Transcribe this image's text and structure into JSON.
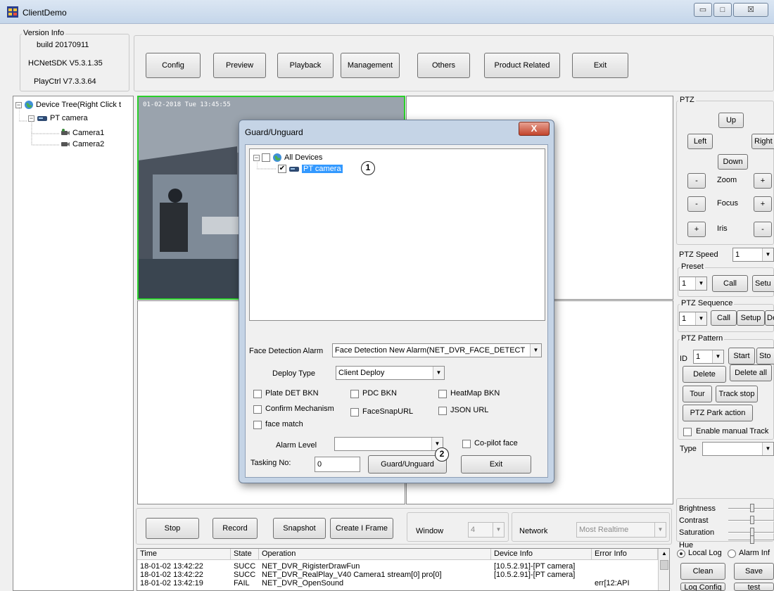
{
  "window": {
    "title": "ClientDemo",
    "minimize": "▭",
    "maximize": "□",
    "close": "☒"
  },
  "version": {
    "legend": "Version Info",
    "build": "build 20170911",
    "sdk": "HCNetSDK V5.3.1.35",
    "playctrl": "PlayCtrl V7.3.3.64"
  },
  "toolbar": {
    "config": "Config",
    "preview": "Preview",
    "playback": "Playback",
    "management": "Management",
    "others": "Others",
    "product_related": "Product Related",
    "exit": "Exit"
  },
  "tree": {
    "root": "Device Tree(Right Click t",
    "device": "PT camera",
    "camera1": "Camera1",
    "camera2": "Camera2"
  },
  "video": {
    "timestamp": "01-02-2018 Tue 13:45:55"
  },
  "dialog": {
    "title": "Guard/Unguard",
    "close": "X",
    "tree_root": "All Devices",
    "tree_device": "PT camera",
    "badge1": "1",
    "badge2": "2",
    "face_alarm_label": "Face Detection Alarm",
    "face_alarm_value": "Face Detection New Alarm(NET_DVR_FACE_DETECT",
    "deploy_type_label": "Deploy Type",
    "deploy_type_value": "Client Deploy",
    "plate_det": "Plate DET BKN",
    "pdc_bkn": "PDC BKN",
    "heatmap_bkn": "HeatMap BKN",
    "confirm_mech": "Confirm Mechanism",
    "facesnap_url": "FaceSnapURL",
    "json_url": "JSON URL",
    "face_match": "face match",
    "alarm_level_label": "Alarm Level",
    "alarm_level_value": "",
    "copilot_face": "Co-pilot face",
    "tasking_label": "Tasking No:",
    "tasking_value": "0",
    "guard_btn": "Guard/Unguard",
    "exit_btn": "Exit"
  },
  "ptz": {
    "legend": "PTZ",
    "up": "Up",
    "left": "Left",
    "right": "Right",
    "down": "Down",
    "zoom_minus": "-",
    "zoom": "Zoom",
    "zoom_plus": "+",
    "focus_minus": "-",
    "focus": "Focus",
    "focus_plus": "+",
    "iris_plus": "+",
    "iris": "Iris",
    "iris_minus": "-",
    "speed_label": "PTZ Speed",
    "speed_value": "1",
    "preset_legend": "Preset",
    "preset_value": "1",
    "call": "Call",
    "setup": "Setu",
    "seq_legend": "PTZ Sequence",
    "seq_value": "1",
    "seq_call": "Call",
    "seq_setup": "Setup",
    "seq_del": "De",
    "pattern_legend": "PTZ Pattern",
    "id_label": "ID",
    "id_value": "1",
    "start": "Start",
    "stop": "Sto",
    "delete": "Delete",
    "delete_all": "Delete all",
    "tour": "Tour",
    "track_stop": "Track stop",
    "park": "PTZ Park action",
    "manual_track": "Enable manual Track",
    "type_label": "Type",
    "type_value": ""
  },
  "image": {
    "brightness": "Brightness",
    "contrast": "Contrast",
    "saturation": "Saturation",
    "hue": "Hue"
  },
  "bottom": {
    "stop": "Stop",
    "record": "Record",
    "snapshot": "Snapshot",
    "iframe": "Create I Frame",
    "window_label": "Window",
    "window_value": "4",
    "network_label": "Network",
    "network_value": "Most Realtime"
  },
  "log": {
    "columns": [
      "Time",
      "State",
      "Operation",
      "Device Info",
      "Error Info"
    ],
    "rows": [
      [
        "18-01-02 13:42:22",
        "SUCC",
        "NET_DVR_RigisterDrawFun",
        "[10.5.2.91]-[PT camera]",
        ""
      ],
      [
        "18-01-02 13:42:22",
        "SUCC",
        "NET_DVR_RealPlay_V40 Camera1 stream[0] pro[0]",
        "[10.5.2.91]-[PT camera]",
        ""
      ],
      [
        "18-01-02 13:42:19",
        "FAIL",
        "NET_DVR_OpenSound",
        "",
        "err[12:API"
      ]
    ],
    "local_log": "Local Log",
    "alarm_info": "Alarm Inf",
    "clean": "Clean",
    "save": "Save",
    "log_config": "Log Config",
    "test": "test"
  }
}
